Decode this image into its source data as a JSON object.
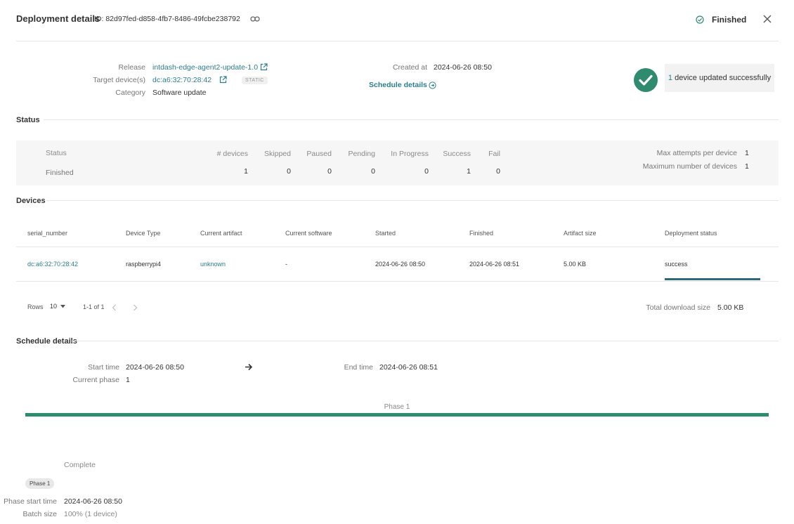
{
  "header": {
    "title": "Deployment details",
    "id_text": "ID: 82d97fed-d858-4fb7-8486-49fcbe238792",
    "status": "Finished"
  },
  "summary": {
    "release_label": "Release",
    "release_value": "intdash-edge-agent2-update-1.0",
    "target_label": "Target device(s)",
    "target_value": "dc:a6:32:70:28:42",
    "target_badge": "STATIC",
    "category_label": "Category",
    "category_value": "Software update",
    "created_label": "Created at",
    "created_value": "2024-06-26 08:50",
    "schedule_link": "Schedule details",
    "success_count": "1",
    "success_text": "device updated successfully"
  },
  "status_section": {
    "title": "Status",
    "status_label": "Status",
    "status_value": "Finished",
    "columns": [
      {
        "label": "# devices",
        "value": "1"
      },
      {
        "label": "Skipped",
        "value": "0"
      },
      {
        "label": "Paused",
        "value": "0"
      },
      {
        "label": "Pending",
        "value": "0"
      },
      {
        "label": "In Progress",
        "value": "0"
      },
      {
        "label": "Success",
        "value": "1"
      },
      {
        "label": "Fail",
        "value": "0"
      }
    ],
    "max_attempts_label": "Max attempts per device",
    "max_attempts_value": "1",
    "max_devices_label": "Maximum number of devices",
    "max_devices_value": "1"
  },
  "devices_section": {
    "title": "Devices",
    "headers": [
      "serial_number",
      "Device Type",
      "Current artifact",
      "Current software",
      "Started",
      "Finished",
      "Artifact size",
      "Deployment status"
    ],
    "rows": [
      {
        "serial": "dc:a6:32:70:28:42",
        "type": "raspberrypi4",
        "artifact": "unknown",
        "software": "-",
        "started": "2024-06-26 08:50",
        "finished": "2024-06-26 08:51",
        "size": "5.00 KB",
        "status": "success",
        "progress": 1.0
      }
    ],
    "rows_label": "Rows",
    "rows_value": "10",
    "pagination": "1-1 of 1",
    "total_label": "Total download size",
    "total_value": "5.00 KB"
  },
  "schedule_section": {
    "title": "Schedule details",
    "start_label": "Start time",
    "start_value": "2024-06-26 08:50",
    "end_label": "End time",
    "end_value": "2024-06-26 08:51",
    "phase_label": "Current phase",
    "phase_value": "1",
    "phase_bar_label": "Phase 1",
    "complete_text": "Complete",
    "phase_chip": "Phase 1",
    "phase_start_label": "Phase start time",
    "phase_start_value": "2024-06-26 08:50",
    "batch_label": "Batch size",
    "batch_value": "100% (1 device)"
  },
  "colors": {
    "accent": "#2a7d8c",
    "success_green": "#2e8b6e",
    "progress_bar": "#2b6a78",
    "phase_bar": "#2e8b6e"
  }
}
